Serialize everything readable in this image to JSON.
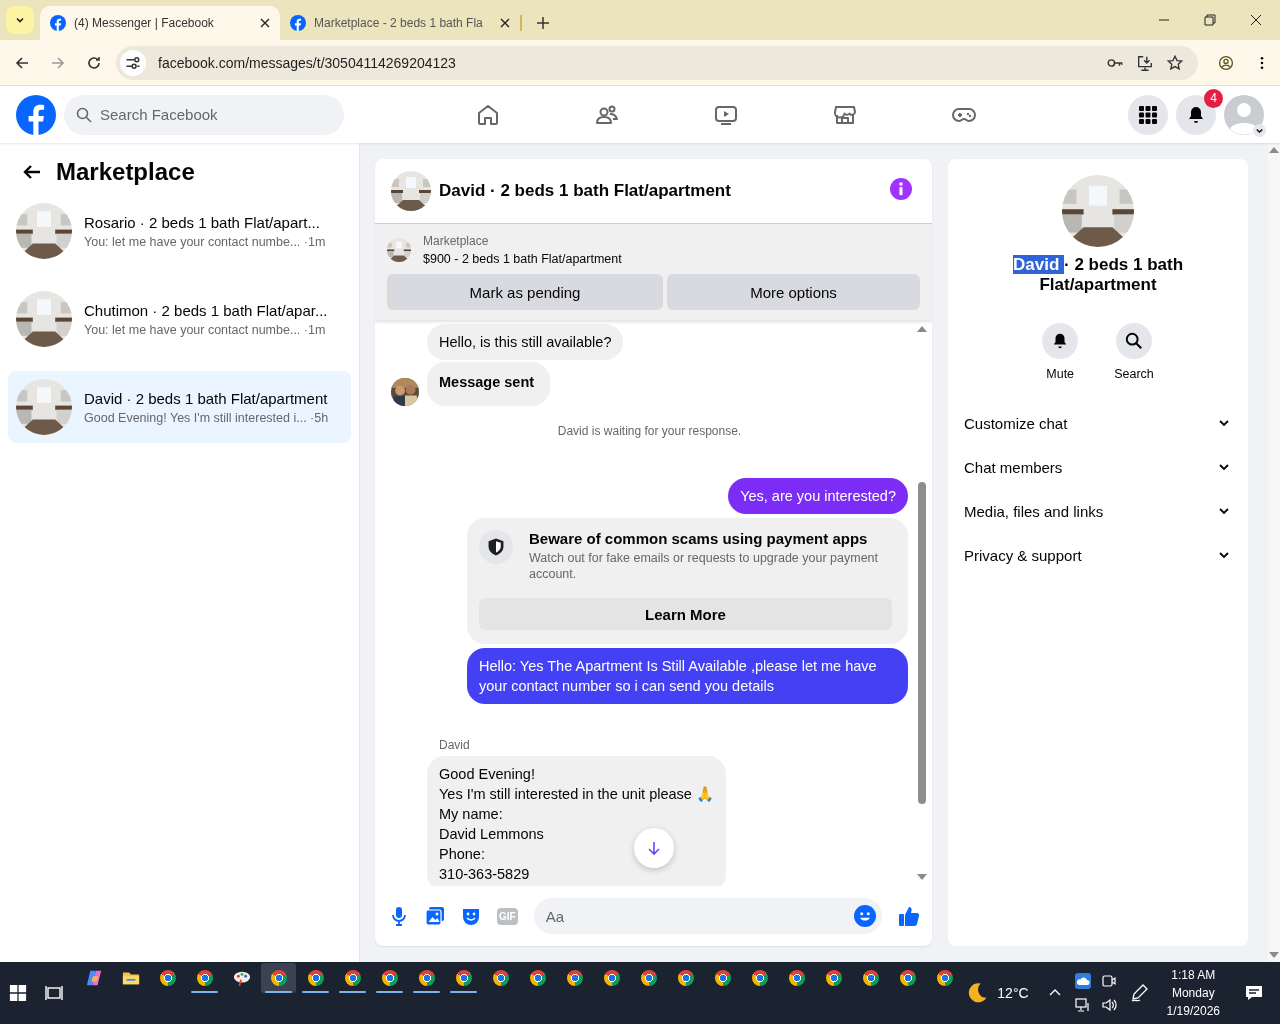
{
  "browser": {
    "tabs": [
      {
        "title": "(4) Messenger | Facebook",
        "selected": true
      },
      {
        "title": "Marketplace - 2 beds 1 bath Fla",
        "selected": false
      }
    ],
    "url": "facebook.com/messages/t/30504114269204123"
  },
  "header": {
    "search_placeholder": "Search Facebook",
    "nav": [
      {
        "kind": "home"
      },
      {
        "kind": "friends"
      },
      {
        "kind": "video"
      },
      {
        "kind": "marketplace"
      },
      {
        "kind": "gaming"
      }
    ],
    "notifications": "4"
  },
  "sidebar": {
    "title": "Marketplace",
    "threads": [
      {
        "name": "Rosario · 2 beds 1 bath Flat/apart...",
        "snippet": "You: let me have your contact numbe... ·1m",
        "selected": false
      },
      {
        "name": "Chutimon · 2 beds 1 bath Flat/apar...",
        "snippet": "You: let me have your contact numbe... ·1m",
        "selected": false
      },
      {
        "name": "David · 2 beds 1 bath Flat/apartment",
        "snippet": "Good Evening! Yes I'm still interested i... ·5h",
        "selected": true
      }
    ]
  },
  "chat": {
    "title": "David · 2 beds 1 bath Flat/apartment",
    "listing": {
      "label": "Marketplace",
      "item": "$900 - 2 beds 1 bath Flat/apartment",
      "buttons": [
        "Mark as pending",
        "More options"
      ]
    },
    "messages": [
      {
        "kind": "in",
        "text": "Hello, is this still available?",
        "avatar": false,
        "bold": false
      },
      {
        "kind": "in",
        "text": "Message sent",
        "avatar": true,
        "bold": true
      },
      {
        "kind": "notice",
        "text": "David is waiting for your response."
      },
      {
        "kind": "out",
        "text": "Yes, are you interested?",
        "color": "#7b2cf5"
      },
      {
        "kind": "alert",
        "title": "Beware of common scams using payment apps",
        "text": "Watch out for fake emails or requests to upgrade your payment account.",
        "button": "Learn More"
      },
      {
        "kind": "out",
        "text": "Hello: Yes The Apartment Is Still Available ,please let me have your contact number so i can send you details",
        "color": "#4441f5"
      },
      {
        "kind": "in",
        "sender": "David",
        "text": "Good Evening!\nYes I'm still interested in the unit please 🙏\nMy name:\nDavid Lemmons\nPhone:\n310-363-5829",
        "avatar": false,
        "bold": false
      }
    ],
    "composer": {
      "gif": "GIF",
      "placeholder": "Aa"
    }
  },
  "details": {
    "title_highlighted": "David ",
    "title_rest": "· 2 beds 1 bath Flat/apartment",
    "actions": [
      {
        "kind": "mute",
        "label": "Mute"
      },
      {
        "kind": "search",
        "label": "Search"
      }
    ],
    "sections": [
      {
        "label": "Customize chat",
        "expanded": false
      },
      {
        "label": "Chat members",
        "expanded": false
      },
      {
        "label": "Media, files and links",
        "expanded": false
      },
      {
        "label": "Privacy & support",
        "expanded": false
      }
    ]
  },
  "taskbar": {
    "apps": [
      {
        "kind": "copilot",
        "running": false,
        "active": false
      },
      {
        "kind": "folder",
        "running": false,
        "active": false
      },
      {
        "kind": "browser",
        "running": false,
        "active": false
      },
      {
        "kind": "browser",
        "running": true,
        "active": false
      },
      {
        "kind": "paint",
        "running": false,
        "active": false
      },
      {
        "kind": "browser",
        "running": true,
        "active": true
      },
      {
        "kind": "browser",
        "running": true,
        "active": false
      },
      {
        "kind": "browser",
        "running": true,
        "active": false
      },
      {
        "kind": "browser",
        "running": true,
        "active": false
      },
      {
        "kind": "browser",
        "running": true,
        "active": false
      },
      {
        "kind": "browser",
        "running": true,
        "active": false
      },
      {
        "kind": "browser",
        "running": false,
        "active": false
      },
      {
        "kind": "browser",
        "running": false,
        "active": false
      },
      {
        "kind": "browser",
        "running": false,
        "active": false
      },
      {
        "kind": "browser",
        "running": false,
        "active": false
      },
      {
        "kind": "browser",
        "running": false,
        "active": false
      },
      {
        "kind": "browser",
        "running": false,
        "active": false
      },
      {
        "kind": "browser",
        "running": false,
        "active": false
      },
      {
        "kind": "browser",
        "running": false,
        "active": false
      },
      {
        "kind": "browser",
        "running": false,
        "active": false
      },
      {
        "kind": "browser",
        "running": false,
        "active": false
      },
      {
        "kind": "browser",
        "running": false,
        "active": false
      },
      {
        "kind": "browser",
        "running": false,
        "active": false
      },
      {
        "kind": "browser",
        "running": false,
        "active": false
      }
    ],
    "temperature": "12°C",
    "time": "1:18 AM",
    "day": "Monday",
    "date": "1/19/2026"
  }
}
